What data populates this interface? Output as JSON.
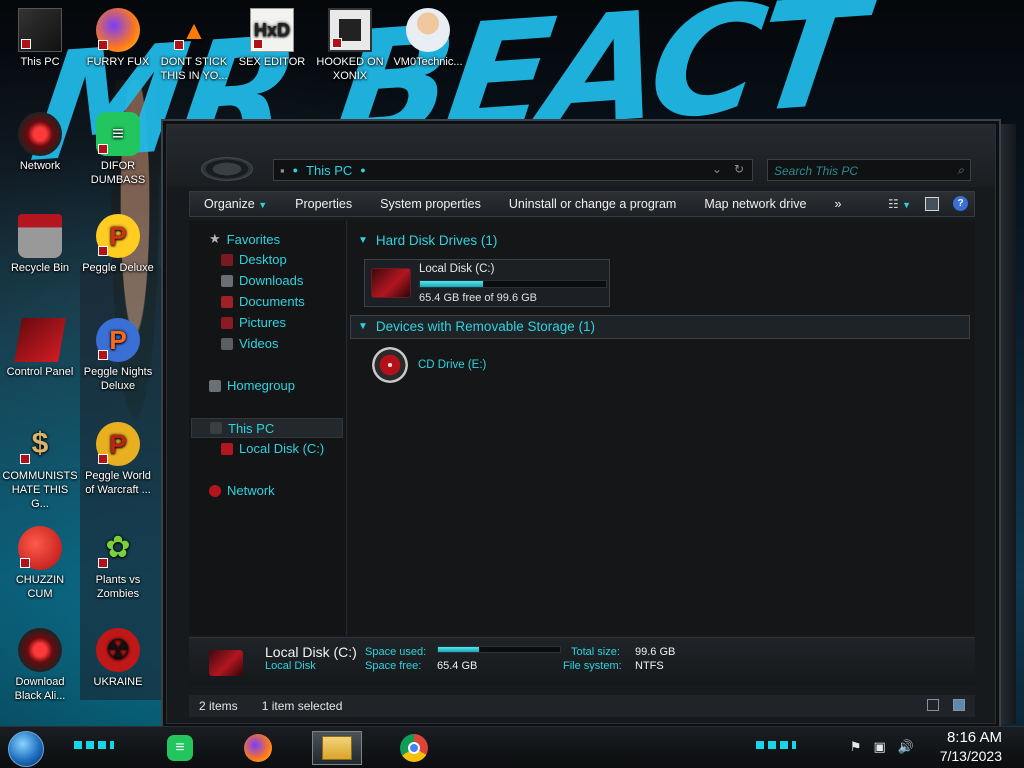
{
  "wallpaper": {
    "text": "MR BEACT"
  },
  "desktop_icons": [
    {
      "label": "This PC"
    },
    {
      "label": "FURRY FUX"
    },
    {
      "label": "DONT STICK THIS IN YO..."
    },
    {
      "label": "SEX EDITOR"
    },
    {
      "label": "HOOKED ON XONIX"
    },
    {
      "label": "VM0Technic..."
    },
    {
      "label": "Network"
    },
    {
      "label": "DIFOR DUMBASS"
    },
    {
      "label": "Recycle Bin"
    },
    {
      "label": "Peggle Deluxe"
    },
    {
      "label": "Control Panel"
    },
    {
      "label": "Peggle Nights Deluxe"
    },
    {
      "label": "COMMUNISTS HATE THIS G..."
    },
    {
      "label": "Peggle World of Warcraft ..."
    },
    {
      "label": "CHUZZIN CUM"
    },
    {
      "label": "Plants vs Zombies"
    },
    {
      "label": "Download Black Ali..."
    },
    {
      "label": "UKRAINE"
    }
  ],
  "window": {
    "address": "This PC",
    "search_placeholder": "Search This PC",
    "toolbar": {
      "organize": "Organize",
      "properties": "Properties",
      "system_properties": "System properties",
      "uninstall": "Uninstall or change a program",
      "map_network_drive": "Map network drive",
      "more": "»"
    },
    "nav": {
      "favorites": "Favorites",
      "desktop": "Desktop",
      "downloads": "Downloads",
      "documents": "Documents",
      "pictures": "Pictures",
      "videos": "Videos",
      "homegroup": "Homegroup",
      "this_pc": "This PC",
      "local_disk": "Local Disk (C:)",
      "network": "Network"
    },
    "content": {
      "hdd_header": "Hard Disk Drives (1)",
      "drive_name": "Local Disk (C:)",
      "drive_free": "65.4 GB free of 99.6 GB",
      "drive_used_fraction": 0.34,
      "removable_header": "Devices with Removable Storage (1)",
      "cd_label": "CD Drive (E:)"
    },
    "details": {
      "title": "Local Disk (C:)",
      "subtitle": "Local Disk",
      "space_used_label": "Space used:",
      "space_free_label": "Space free:",
      "space_free_value": "65.4 GB",
      "total_size_label": "Total size:",
      "total_size_value": "99.6 GB",
      "file_system_label": "File system:",
      "file_system_value": "NTFS"
    },
    "status": {
      "items": "2 items",
      "selected": "1 item selected"
    }
  },
  "taskbar": {
    "time": "8:16 AM",
    "date": "7/13/2023"
  },
  "colors": {
    "accent_cyan": "#2ed3e0",
    "brand_red": "#b41620",
    "window_bg": "#141618"
  }
}
